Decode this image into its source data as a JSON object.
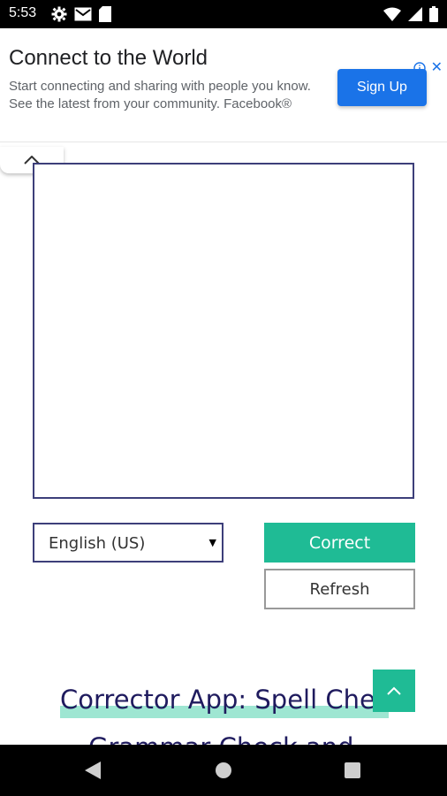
{
  "status_bar": {
    "time": "5:53",
    "icons_left": [
      "gear-icon",
      "gmail-icon",
      "sd-card-icon"
    ],
    "icons_right": [
      "wifi-icon",
      "signal-icon",
      "battery-icon"
    ]
  },
  "ad": {
    "title": "Connect to the World",
    "description": "Start connecting and sharing with people you know. See the latest from your community. Facebook®",
    "cta_label": "Sign Up",
    "close_glyph": "✕"
  },
  "editor": {
    "text_value": ""
  },
  "language_select": {
    "selected": "English (US)"
  },
  "buttons": {
    "correct_label": "Correct",
    "refresh_label": "Refresh"
  },
  "article": {
    "heading_line1": "Corrector App: Spell Check,",
    "heading_line2": "Grammar Check and"
  },
  "colors": {
    "accent": "#1fbb95",
    "border": "#3d3f7a",
    "heading": "#1f1b5e",
    "ad_button": "#1a73e8"
  }
}
